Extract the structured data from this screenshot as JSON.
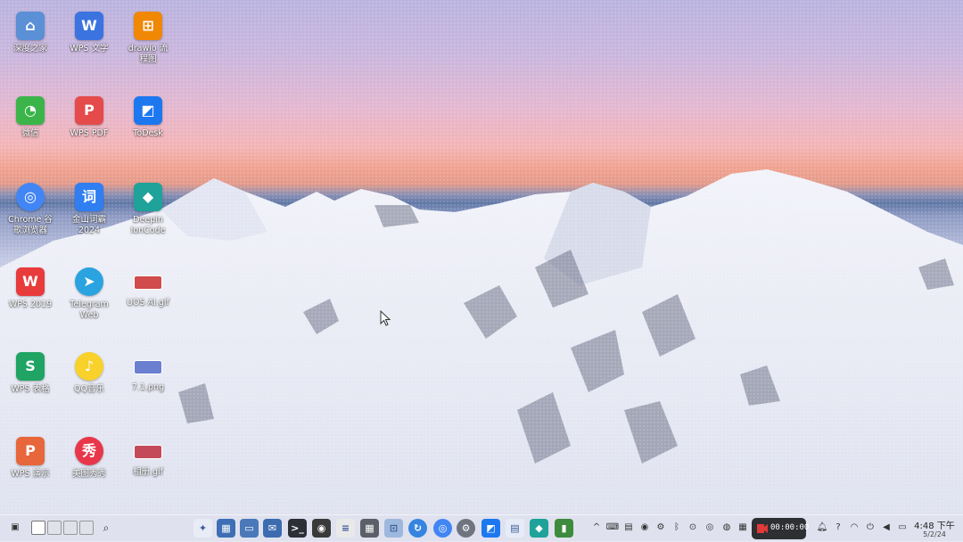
{
  "desktop": {
    "icons": [
      {
        "name": "deepin-home",
        "label": "深度之家",
        "color": "#5b8fd6"
      },
      {
        "name": "wps-writer",
        "label": "WPS 文字",
        "color": "#3b73e0"
      },
      {
        "name": "drawio",
        "label": "drawio 流\n程图",
        "color": "#f08705"
      },
      {
        "name": "wechat",
        "label": "微信",
        "color": "#3bb54a"
      },
      {
        "name": "wps-pdf",
        "label": "WPS PDF",
        "color": "#e54b4b"
      },
      {
        "name": "todesk",
        "label": "ToDesk",
        "color": "#1d78f0"
      },
      {
        "name": "chrome",
        "label": "Chrome 谷\n歌浏览器",
        "color": "#4285f4"
      },
      {
        "name": "jinshan-ciba",
        "label": "金山词霸\n2024",
        "color": "#2f7ef2"
      },
      {
        "name": "deepin-ioncode",
        "label": "Deepin\nIonCode",
        "color": "#1fa29a"
      },
      {
        "name": "wps-2019",
        "label": "WPS 2019",
        "color": "#e83b3b"
      },
      {
        "name": "telegram-web",
        "label": "Telegram\nWeb",
        "color": "#2aa3e0"
      },
      {
        "name": "uos-ai-gif",
        "label": "UOS AI.gif",
        "color": "#d04b4b"
      },
      {
        "name": "wps-sheet",
        "label": "WPS 表格",
        "color": "#1fa463"
      },
      {
        "name": "qq-music",
        "label": "QQ音乐",
        "color": "#f8d12b"
      },
      {
        "name": "image-7-1-png",
        "label": "7.1.png",
        "color": "#6a7fd0"
      },
      {
        "name": "wps-slides",
        "label": "WPS 演示",
        "color": "#e8663b"
      },
      {
        "name": "meitu-xiuxiu",
        "label": "美图秀秀",
        "color": "#e8374a"
      },
      {
        "name": "album-gif",
        "label": "相册.gif",
        "color": "#c44a5a"
      }
    ]
  },
  "taskbar": {
    "recorder_time": "00:00:00",
    "clock_time": "4:48 下午",
    "clock_date": "5/2/24",
    "pinned": [
      "launcher",
      "multitask-view",
      "file-manager",
      "mail",
      "terminal",
      "music-player",
      "text-editor",
      "calculator",
      "screenshot",
      "app-store",
      "chrome",
      "control-center",
      "todesk",
      "document-viewer",
      "deepin-ioncode",
      "android-app"
    ]
  }
}
